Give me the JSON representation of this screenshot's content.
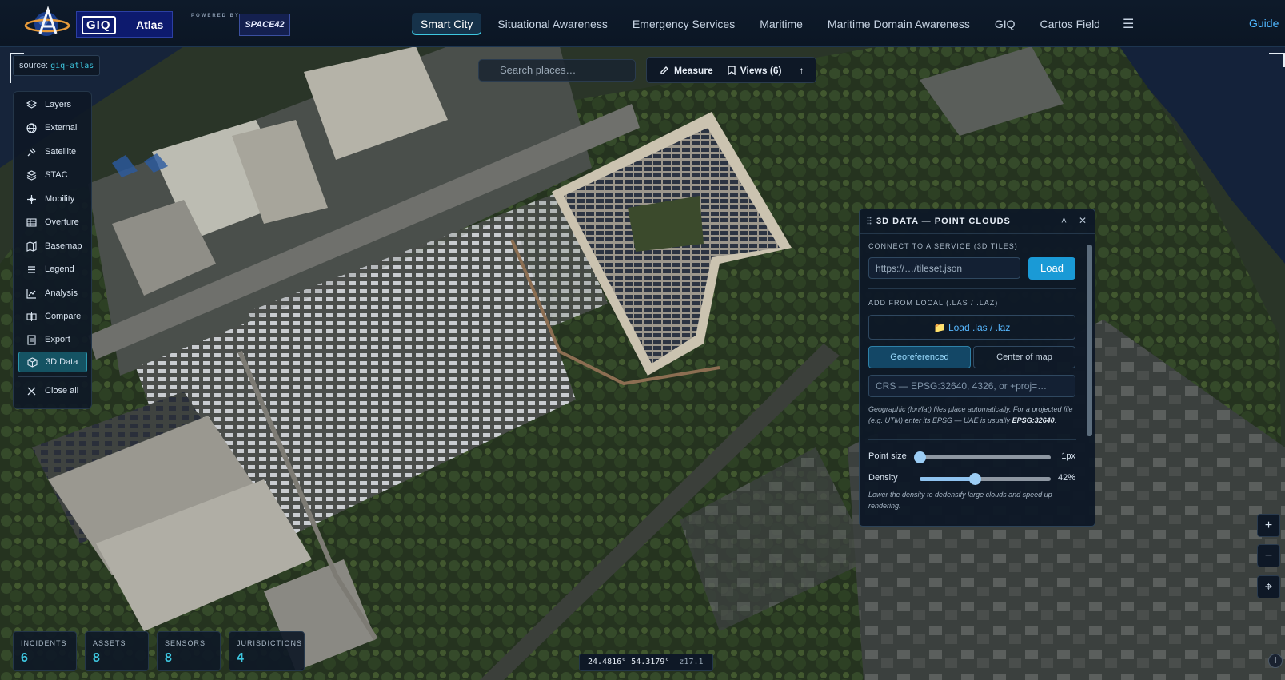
{
  "brand": {
    "logo_text": "GIQ",
    "app_name": "Atlas",
    "powered_by": "POWERED BY",
    "partner_logo": "SPACE42"
  },
  "nav": {
    "items": [
      {
        "label": "Smart City",
        "active": true
      },
      {
        "label": "Situational Awareness",
        "active": false
      },
      {
        "label": "Emergency Services",
        "active": false
      },
      {
        "label": "Maritime",
        "active": false
      },
      {
        "label": "Maritime Domain Awareness",
        "active": false
      },
      {
        "label": "GIQ",
        "active": false
      },
      {
        "label": "Cartos Field",
        "active": false
      }
    ],
    "menu_icon": "☰",
    "guide": "Guide"
  },
  "source": {
    "prefix": "source:",
    "value": "giq-atlas"
  },
  "search": {
    "placeholder": "Search places…"
  },
  "toolbar": {
    "measure": "Measure",
    "views": "Views (6)",
    "collapse": "↑"
  },
  "sidebar": {
    "items": [
      {
        "label": "Layers",
        "icon": "layers-icon"
      },
      {
        "label": "External",
        "icon": "globe-icon"
      },
      {
        "label": "Satellite",
        "icon": "satellite-icon"
      },
      {
        "label": "STAC",
        "icon": "stack-icon"
      },
      {
        "label": "Mobility",
        "icon": "mobility-icon"
      },
      {
        "label": "Overture",
        "icon": "grid-icon"
      },
      {
        "label": "Basemap",
        "icon": "map-icon"
      },
      {
        "label": "Legend",
        "icon": "list-icon"
      },
      {
        "label": "Analysis",
        "icon": "chart-icon"
      },
      {
        "label": "Compare",
        "icon": "compare-icon"
      },
      {
        "label": "Export",
        "icon": "export-icon"
      },
      {
        "label": "3D Data",
        "icon": "cube-icon",
        "active": true
      }
    ],
    "close_all": "Close all"
  },
  "panel": {
    "title": "3D DATA — POINT CLOUDS",
    "minimize": "˄",
    "close": "✕",
    "service_label": "CONNECT TO A SERVICE (3D TILES)",
    "url_placeholder": "https://…/tileset.json",
    "load": "Load",
    "local_label": "ADD FROM LOCAL (.LAS / .LAZ)",
    "load_local": "📁 Load .las / .laz",
    "georeferenced": "Georeferenced",
    "center_of_map": "Center of map",
    "crs_placeholder": "CRS — EPSG:32640, 4326, or +proj=…",
    "help_text": "Geographic (lon/lat) files place automatically. For a projected file (e.g. UTM) enter its EPSG — UAE is usually",
    "help_bold": "EPSG:32640",
    "help_end": ".",
    "point_size_label": "Point size",
    "point_size_value": "1px",
    "point_size_fraction": 0.0,
    "density_label": "Density",
    "density_value": "42%",
    "density_fraction": 0.42,
    "density_help": "Lower the density to dedensify large clouds and speed up rendering."
  },
  "zoom": {
    "in": "+",
    "out": "−",
    "locate": "⌖"
  },
  "stats": [
    {
      "label": "INCIDENTS",
      "value": "6"
    },
    {
      "label": "ASSETS",
      "value": "8"
    },
    {
      "label": "SENSORS",
      "value": "8"
    },
    {
      "label": "JURISDICTIONS",
      "value": "4"
    }
  ],
  "coords": {
    "lat": "24.4816°",
    "lon": "54.3179°",
    "zoom": "z17.1"
  },
  "info": "i",
  "colors": {
    "accent": "#3ec7e0",
    "primary_button": "#1a9ad6",
    "link": "#57b8ff",
    "active_item": "#155363"
  }
}
